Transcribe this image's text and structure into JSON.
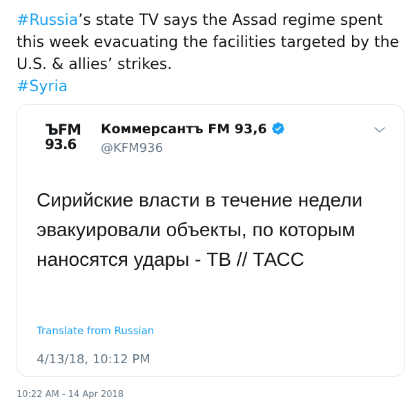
{
  "tweet": {
    "hashtag_1": "#Russia",
    "text_1": "’s state TV says the Assad regime spent this week evacuating the facilities targeted by the U.S. & allies’ strikes.",
    "hashtag_2": "#Syria",
    "timestamp": "10:22 AM - 14 Apr 2018"
  },
  "quoted_tweet": {
    "avatar_line1": "ЪFM",
    "avatar_line2": "93.6",
    "display_name": "Коммерсантъ FM 93,6",
    "handle": "@KFM936",
    "verified_icon": "verified-badge-icon",
    "menu_icon": "chevron-down-icon",
    "body": "Сирийские власти в течение недели эвакуировали объекты, по которым наносятся удары - ТВ // ТАСС",
    "translate_label": "Translate from Russian",
    "timestamp": "4/13/18, 10:12 PM"
  },
  "colors": {
    "link": "#1da1f2",
    "text": "#14171a",
    "secondary": "#657786",
    "border": "#e1e8ed"
  }
}
